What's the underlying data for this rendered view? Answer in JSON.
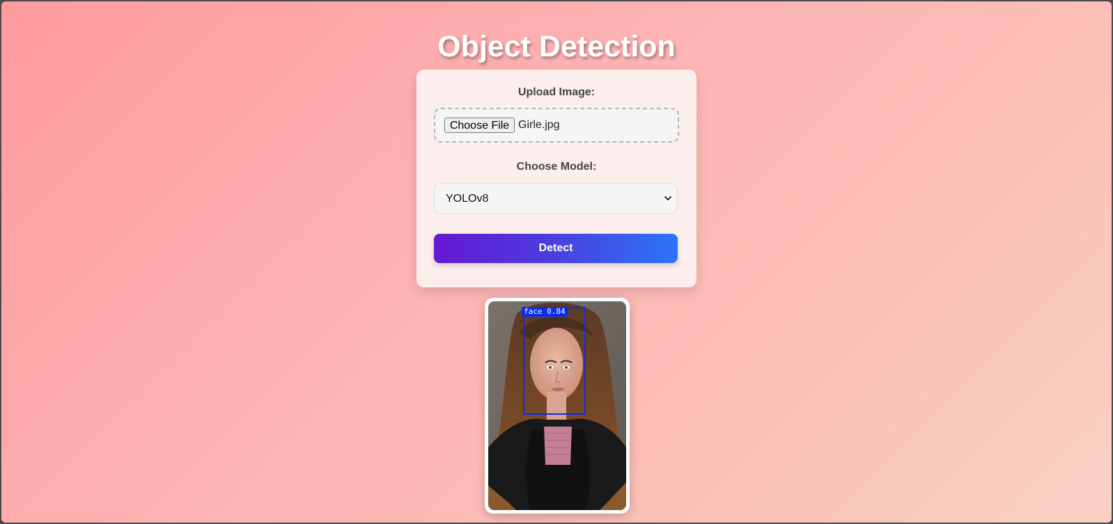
{
  "page": {
    "title": "Object Detection"
  },
  "form": {
    "upload_label": "Upload Image:",
    "file_button_label": "Choose File",
    "file_name": "Girle.jpg",
    "model_label": "Choose Model:",
    "model_selected": "YOLOv8",
    "detect_label": "Detect"
  },
  "result": {
    "detections": [
      {
        "label": "face 0.84",
        "class": "face",
        "confidence": 0.84
      }
    ]
  },
  "colors": {
    "detect_gradient_start": "#6418d2",
    "detect_gradient_end": "#2c74f8",
    "bbox": "#0a2df0"
  },
  "icons": {
    "select_arrow": "chevron-down-icon"
  }
}
